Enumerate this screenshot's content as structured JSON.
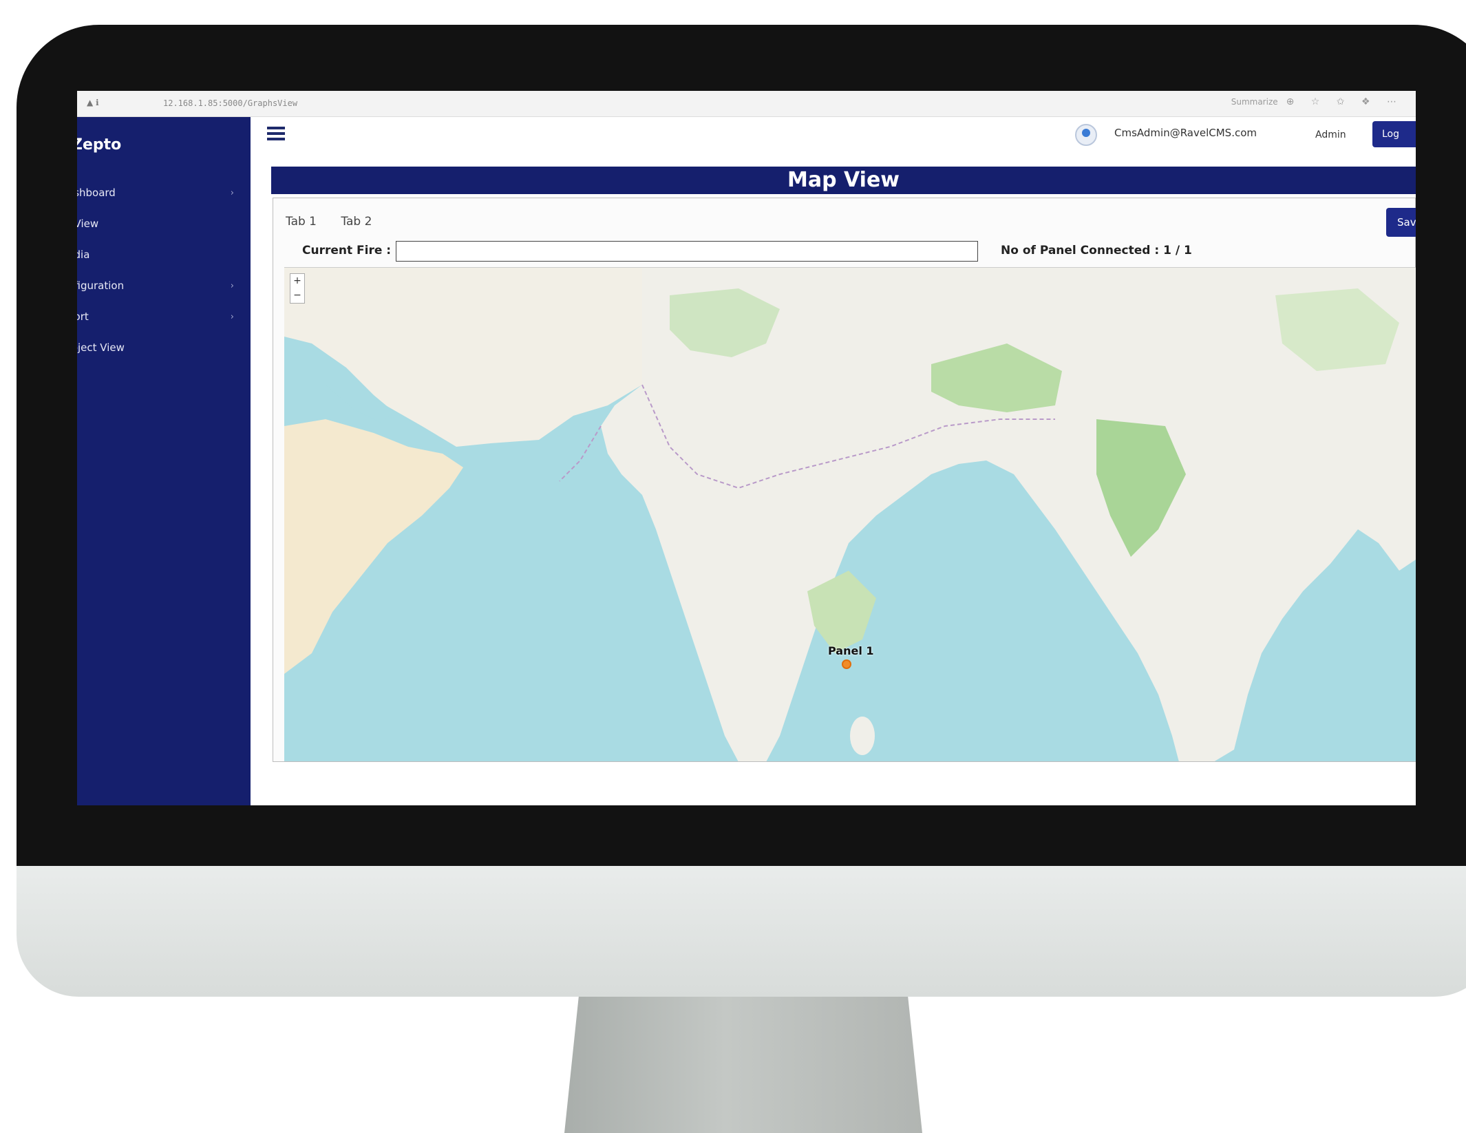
{
  "browser": {
    "url": "12.168.1.85:5000/GraphsView",
    "actions_label": "Summarize"
  },
  "sidebar": {
    "brand": "Zepto",
    "items": [
      {
        "label": "ashboard",
        "has_chevron": true
      },
      {
        "label": "pView",
        "has_chevron": false
      },
      {
        "label": "ndia",
        "has_chevron": false
      },
      {
        "label": "nfiguration",
        "has_chevron": true
      },
      {
        "label": "port",
        "has_chevron": true
      },
      {
        "label": "roject View",
        "has_chevron": false
      }
    ]
  },
  "header": {
    "email": "CmsAdmin@RavelCMS.com",
    "role": "Admin",
    "logout_label": "Log"
  },
  "page": {
    "title": "Map View",
    "tabs": [
      "Tab 1",
      "Tab 2"
    ],
    "save_label": "Sav",
    "current_fire_label": "Current Fire :",
    "current_fire_value": "",
    "panels_connected_label": "No of Panel Connected : 1 / 1"
  },
  "map": {
    "zoom_in": "+",
    "zoom_out": "−",
    "marker_label": "Panel 1",
    "marker_color": "#f28c28",
    "water_color": "#a9dbe3",
    "land_color": "#f0efe9"
  }
}
